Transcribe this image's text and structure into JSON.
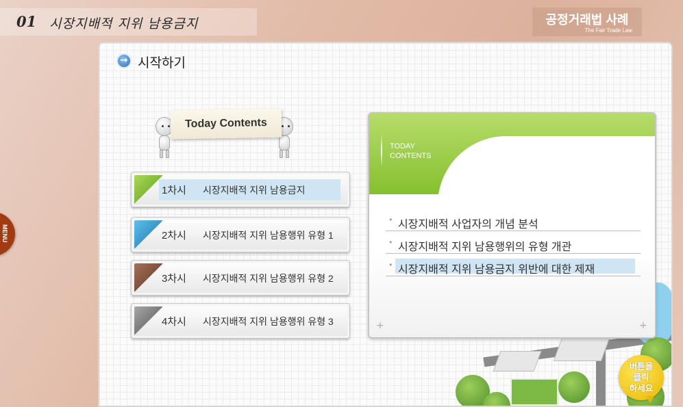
{
  "header": {
    "lesson_number": "01",
    "lesson_title": "시장지배적 지위 남용금지",
    "course_title": "공정거래법 사례",
    "course_subtitle": "The Fair Trade Law"
  },
  "side_menu": {
    "label": "MENU"
  },
  "start": {
    "title": "시작하기",
    "icon": "arrow-right-circle-icon"
  },
  "today": {
    "sign_label": "Today Contents"
  },
  "sessions": [
    {
      "number": "1차시",
      "title": "시장지배적 지위 남용금지",
      "accent": "#7dbb2c",
      "selected": true
    },
    {
      "number": "2차시",
      "title": "시장지배적 지위 남용행위 유형 1",
      "accent": "#2a8fc8",
      "selected": false
    },
    {
      "number": "3차시",
      "title": "시장지배적 지위 남용행위 유형 2",
      "accent": "#7a4a33",
      "selected": false
    },
    {
      "number": "4차시",
      "title": "시장지배적 지위 남용행위 유형 3",
      "accent": "#6b6b6b",
      "selected": false
    }
  ],
  "content_box": {
    "tag_line1": "TODAY",
    "tag_line2": "CONTENTS",
    "topics": [
      {
        "text": "시장지배적 사업자의 개념 분석",
        "selected": false
      },
      {
        "text": "시장지배적 지위 남용행위의 유형 개관",
        "selected": false
      },
      {
        "text": "시장지배적 지위 남용금지 위반에 대한 제재",
        "selected": true
      }
    ],
    "plus_left": "+",
    "plus_right": "+"
  },
  "click_button": {
    "line1": "버튼을",
    "line2": "클릭",
    "line3": "하세요"
  }
}
